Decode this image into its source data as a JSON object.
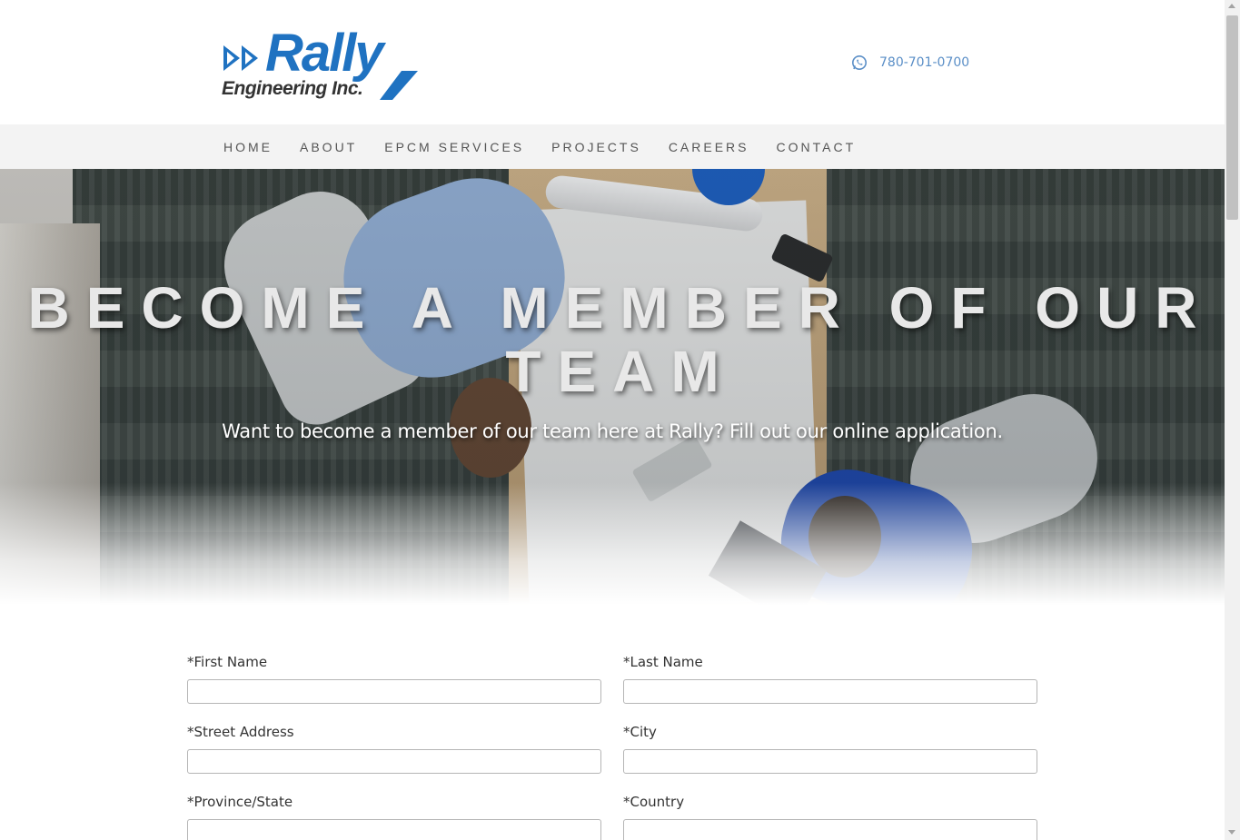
{
  "brand": {
    "name": "Rally",
    "subtitle": "Engineering Inc.",
    "accent_color": "#1f72c1"
  },
  "header": {
    "phone_icon": "whatsapp-icon",
    "phone": "780-701-0700"
  },
  "nav": {
    "items": [
      {
        "label": "HOME"
      },
      {
        "label": "ABOUT"
      },
      {
        "label": "EPCM SERVICES"
      },
      {
        "label": "PROJECTS"
      },
      {
        "label": "CAREERS"
      },
      {
        "label": "CONTACT"
      }
    ]
  },
  "hero": {
    "title": "BECOME A MEMBER OF OUR TEAM",
    "subtitle": "Want to become a member of our team here at Rally? Fill out our online application."
  },
  "form": {
    "fields": [
      {
        "label": "*First Name",
        "value": ""
      },
      {
        "label": "*Last Name",
        "value": ""
      },
      {
        "label": "*Street Address",
        "value": ""
      },
      {
        "label": "*City",
        "value": ""
      },
      {
        "label": "*Province/State",
        "value": ""
      },
      {
        "label": "*Country",
        "value": ""
      }
    ]
  }
}
